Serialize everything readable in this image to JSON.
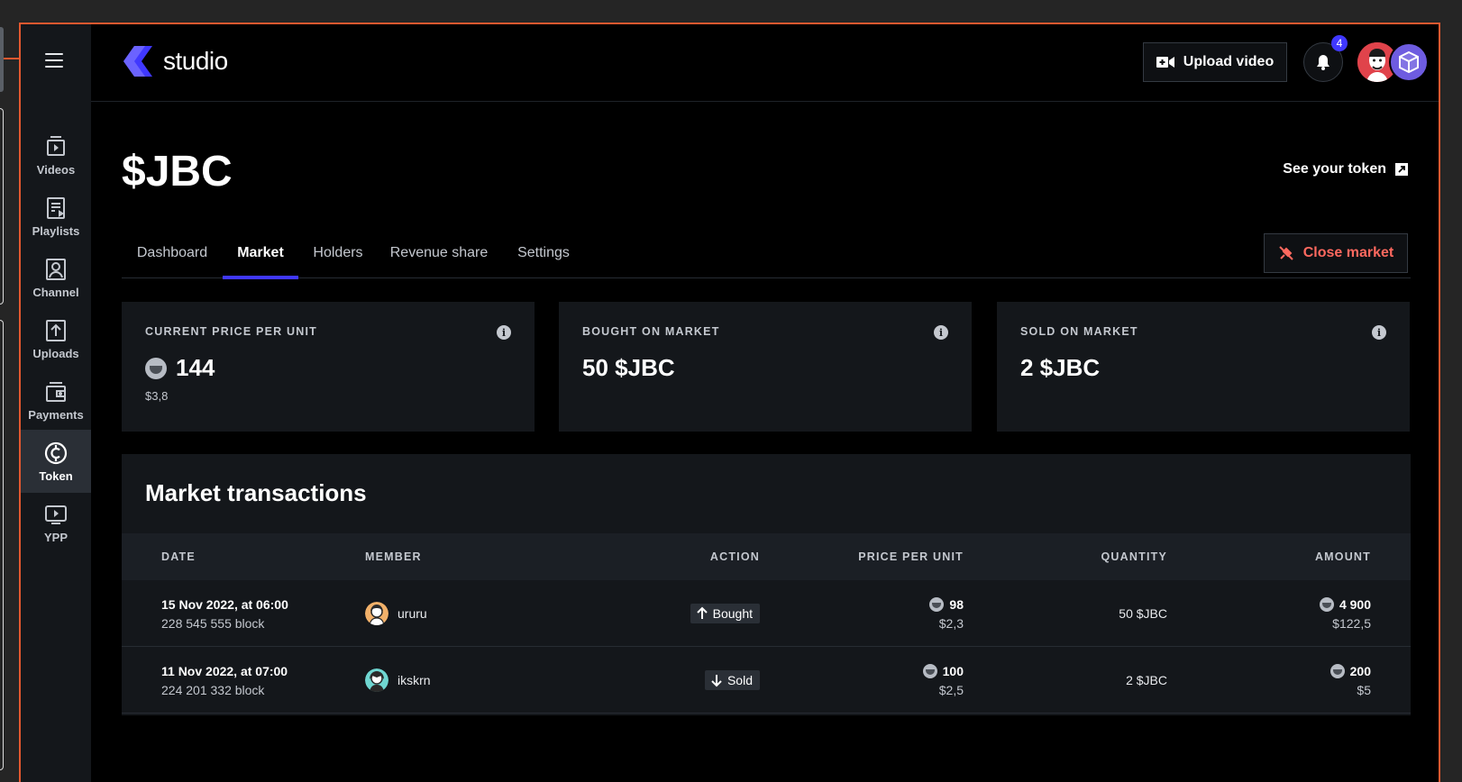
{
  "app": {
    "logo_text": "studio"
  },
  "sidebar": {
    "items": [
      {
        "label": "Videos",
        "icon": "video-file-icon"
      },
      {
        "label": "Playlists",
        "icon": "playlist-icon"
      },
      {
        "label": "Channel",
        "icon": "channel-icon"
      },
      {
        "label": "Uploads",
        "icon": "upload-icon"
      },
      {
        "label": "Payments",
        "icon": "wallet-icon"
      },
      {
        "label": "Token",
        "icon": "token-icon",
        "active": true
      },
      {
        "label": "YPP",
        "icon": "ypp-icon"
      }
    ]
  },
  "topbar": {
    "upload_label": "Upload video",
    "notification_count": "4"
  },
  "page": {
    "title": "$JBC",
    "see_token_label": "See your token",
    "close_market_label": "Close market",
    "accent_color": "#4038ff",
    "danger_color": "#ff695f"
  },
  "tabs": [
    {
      "label": "Dashboard"
    },
    {
      "label": "Market",
      "active": true
    },
    {
      "label": "Holders"
    },
    {
      "label": "Revenue share"
    },
    {
      "label": "Settings"
    }
  ],
  "stats": [
    {
      "label": "CURRENT PRICE PER UNIT",
      "value": "144",
      "sub": "$3,8"
    },
    {
      "label": "BOUGHT ON MARKET",
      "value": "50 $JBC"
    },
    {
      "label": "SOLD ON MARKET",
      "value": "2 $JBC"
    }
  ],
  "transactions": {
    "title": "Market transactions",
    "columns": [
      "DATE",
      "MEMBER",
      "ACTION",
      "PRICE PER UNIT",
      "QUANTITY",
      "AMOUNT"
    ],
    "rows": [
      {
        "date": "15 Nov 2022, at 06:00",
        "block": "228 545 555 block",
        "member": "ururu",
        "action": "Bought",
        "price": "98",
        "price_usd": "$2,3",
        "quantity": "50 $JBC",
        "amount": "4 900",
        "amount_usd": "$122,5"
      },
      {
        "date": "11 Nov 2022, at 07:00",
        "block": "224 201 332 block",
        "member": "ikskrn",
        "action": "Sold",
        "price": "100",
        "price_usd": "$2,5",
        "quantity": "2 $JBC",
        "amount": "200",
        "amount_usd": "$5"
      }
    ]
  }
}
